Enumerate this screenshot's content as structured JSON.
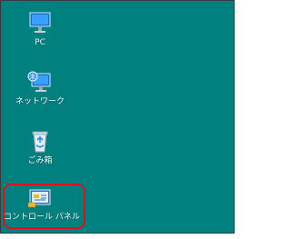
{
  "desktop": {
    "background_color": "#00807f",
    "icons": [
      {
        "label": "PC",
        "icon": "computer-icon"
      },
      {
        "label": "ネットワーク",
        "icon": "network-icon"
      },
      {
        "label": "ごみ箱",
        "icon": "recycle-bin-icon"
      },
      {
        "label": "コントロール パネル",
        "icon": "control-panel-icon"
      }
    ],
    "highlight_color": "#e0101a"
  }
}
